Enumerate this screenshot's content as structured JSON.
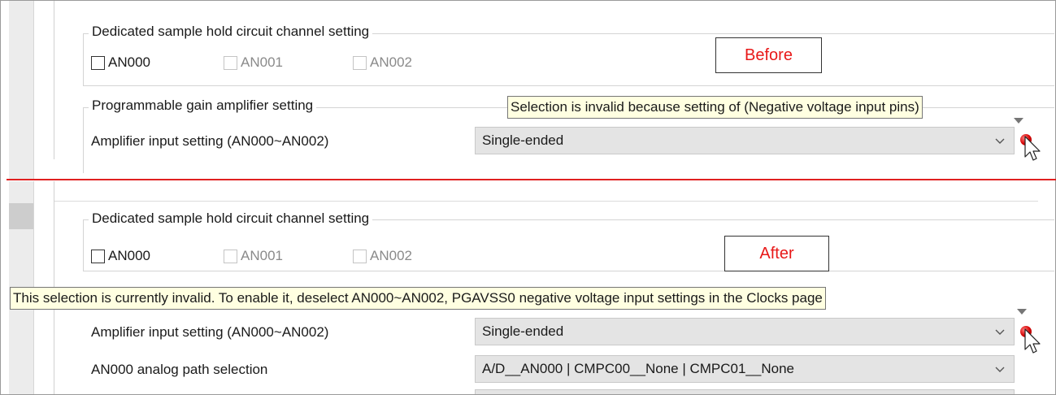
{
  "before_panel": {
    "tag": "Before",
    "sample_hold": {
      "title": "Dedicated sample hold circuit channel setting",
      "channels": [
        {
          "label": "AN000",
          "checked": false,
          "enabled": true
        },
        {
          "label": "AN001",
          "checked": false,
          "enabled": false
        },
        {
          "label": "AN002",
          "checked": false,
          "enabled": false
        }
      ]
    },
    "pga": {
      "title": "Programmable gain amplifier setting",
      "amplifier_label": "Amplifier input setting (AN000~AN002)",
      "amplifier_value": "Single-ended"
    },
    "tooltip": "Selection is invalid because setting of (Negative voltage input pins)"
  },
  "after_panel": {
    "tag": "After",
    "sample_hold": {
      "title": "Dedicated sample hold circuit channel setting",
      "channels": [
        {
          "label": "AN000",
          "checked": false,
          "enabled": true
        },
        {
          "label": "AN001",
          "checked": false,
          "enabled": false
        },
        {
          "label": "AN002",
          "checked": false,
          "enabled": false
        }
      ]
    },
    "tooltip": "This selection is currently invalid. To enable it, deselect AN000~AN002, PGAVSS0 negative voltage input settings in the Clocks page",
    "amplifier_label": "Amplifier input setting (AN000~AN002)",
    "amplifier_value": "Single-ended",
    "analog_path_label": "AN000 analog path selection",
    "analog_path_value": "A/D__AN000 | CMPC00__None | CMPC01__None"
  },
  "colors": {
    "divider": "#e02020",
    "tag_text": "#e81818",
    "tooltip_bg": "#ffffe1",
    "error_icon": "#d40000"
  }
}
